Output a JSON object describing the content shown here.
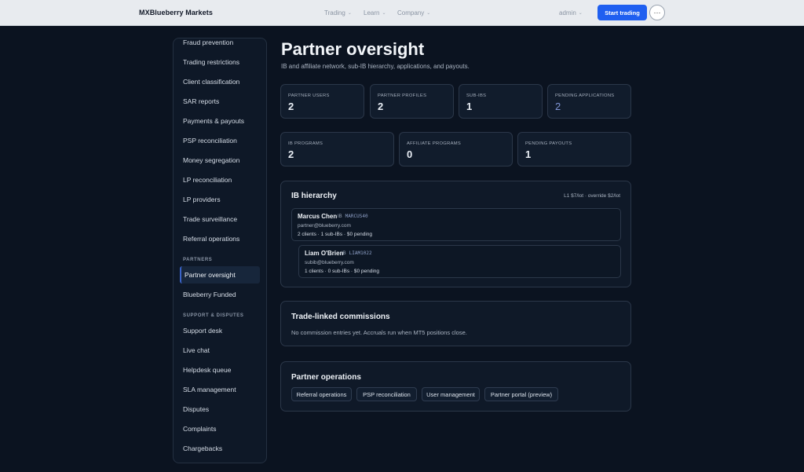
{
  "brand": "MXBlueberry Markets",
  "nav": [
    {
      "label": "Trading"
    },
    {
      "label": "Learn"
    },
    {
      "label": "Company"
    }
  ],
  "user": {
    "label": "admin"
  },
  "cta": {
    "label": "Start trading"
  },
  "more": {
    "label": "···"
  },
  "sidebar": {
    "items_top": [
      "Fraud prevention",
      "Trading restrictions",
      "Client classification",
      "SAR reports",
      "Payments & payouts",
      "PSP reconciliation",
      "Money segregation",
      "LP reconciliation",
      "LP providers",
      "Trade surveillance",
      "Referral operations"
    ],
    "section_partners": "PARTNERS",
    "partners_items": [
      "Partner oversight",
      "Blueberry Funded"
    ],
    "section_support": "SUPPORT & DISPUTES",
    "support_items": [
      "Support desk",
      "Live chat",
      "Helpdesk queue",
      "SLA management",
      "Disputes",
      "Complaints",
      "Chargebacks"
    ]
  },
  "page": {
    "title": "Partner oversight",
    "subtitle": "IB and affiliate network, sub-IB hierarchy, applications, and payouts."
  },
  "stats_row1": [
    {
      "label": "PARTNER USERS",
      "value": "2"
    },
    {
      "label": "PARTNER PROFILES",
      "value": "2"
    },
    {
      "label": "SUB-IBS",
      "value": "1"
    },
    {
      "label": "PENDING APPLICATIONS",
      "value": "2"
    }
  ],
  "stats_row2": [
    {
      "label": "IB PROGRAMS",
      "value": "2"
    },
    {
      "label": "AFFILIATE PROGRAMS",
      "value": "0"
    },
    {
      "label": "PENDING PAYOUTS",
      "value": "1"
    }
  ],
  "ib_hierarchy": {
    "title": "IB hierarchy",
    "rate": "L1 $7/lot · override $2/lot",
    "nodes": [
      {
        "name": "Marcus Chen",
        "prefix": "IB",
        "code": "MARCUS40",
        "email": "partner@blueberry.com",
        "meta": "2 clients · 1 sub-IBs · $0 pending"
      },
      {
        "name": "Liam O'Brien",
        "prefix": "IB",
        "code": "LIAM1022",
        "email": "subib@blueberry.com",
        "meta": "1 clients · 0 sub-IBs · $0 pending"
      }
    ]
  },
  "commissions": {
    "title": "Trade-linked commissions",
    "note": "No commission entries yet. Accruals run when MT5 positions close."
  },
  "operations": {
    "title": "Partner operations",
    "links": [
      "Referral operations",
      "PSP reconciliation",
      "User management",
      "Partner portal (preview)"
    ]
  }
}
